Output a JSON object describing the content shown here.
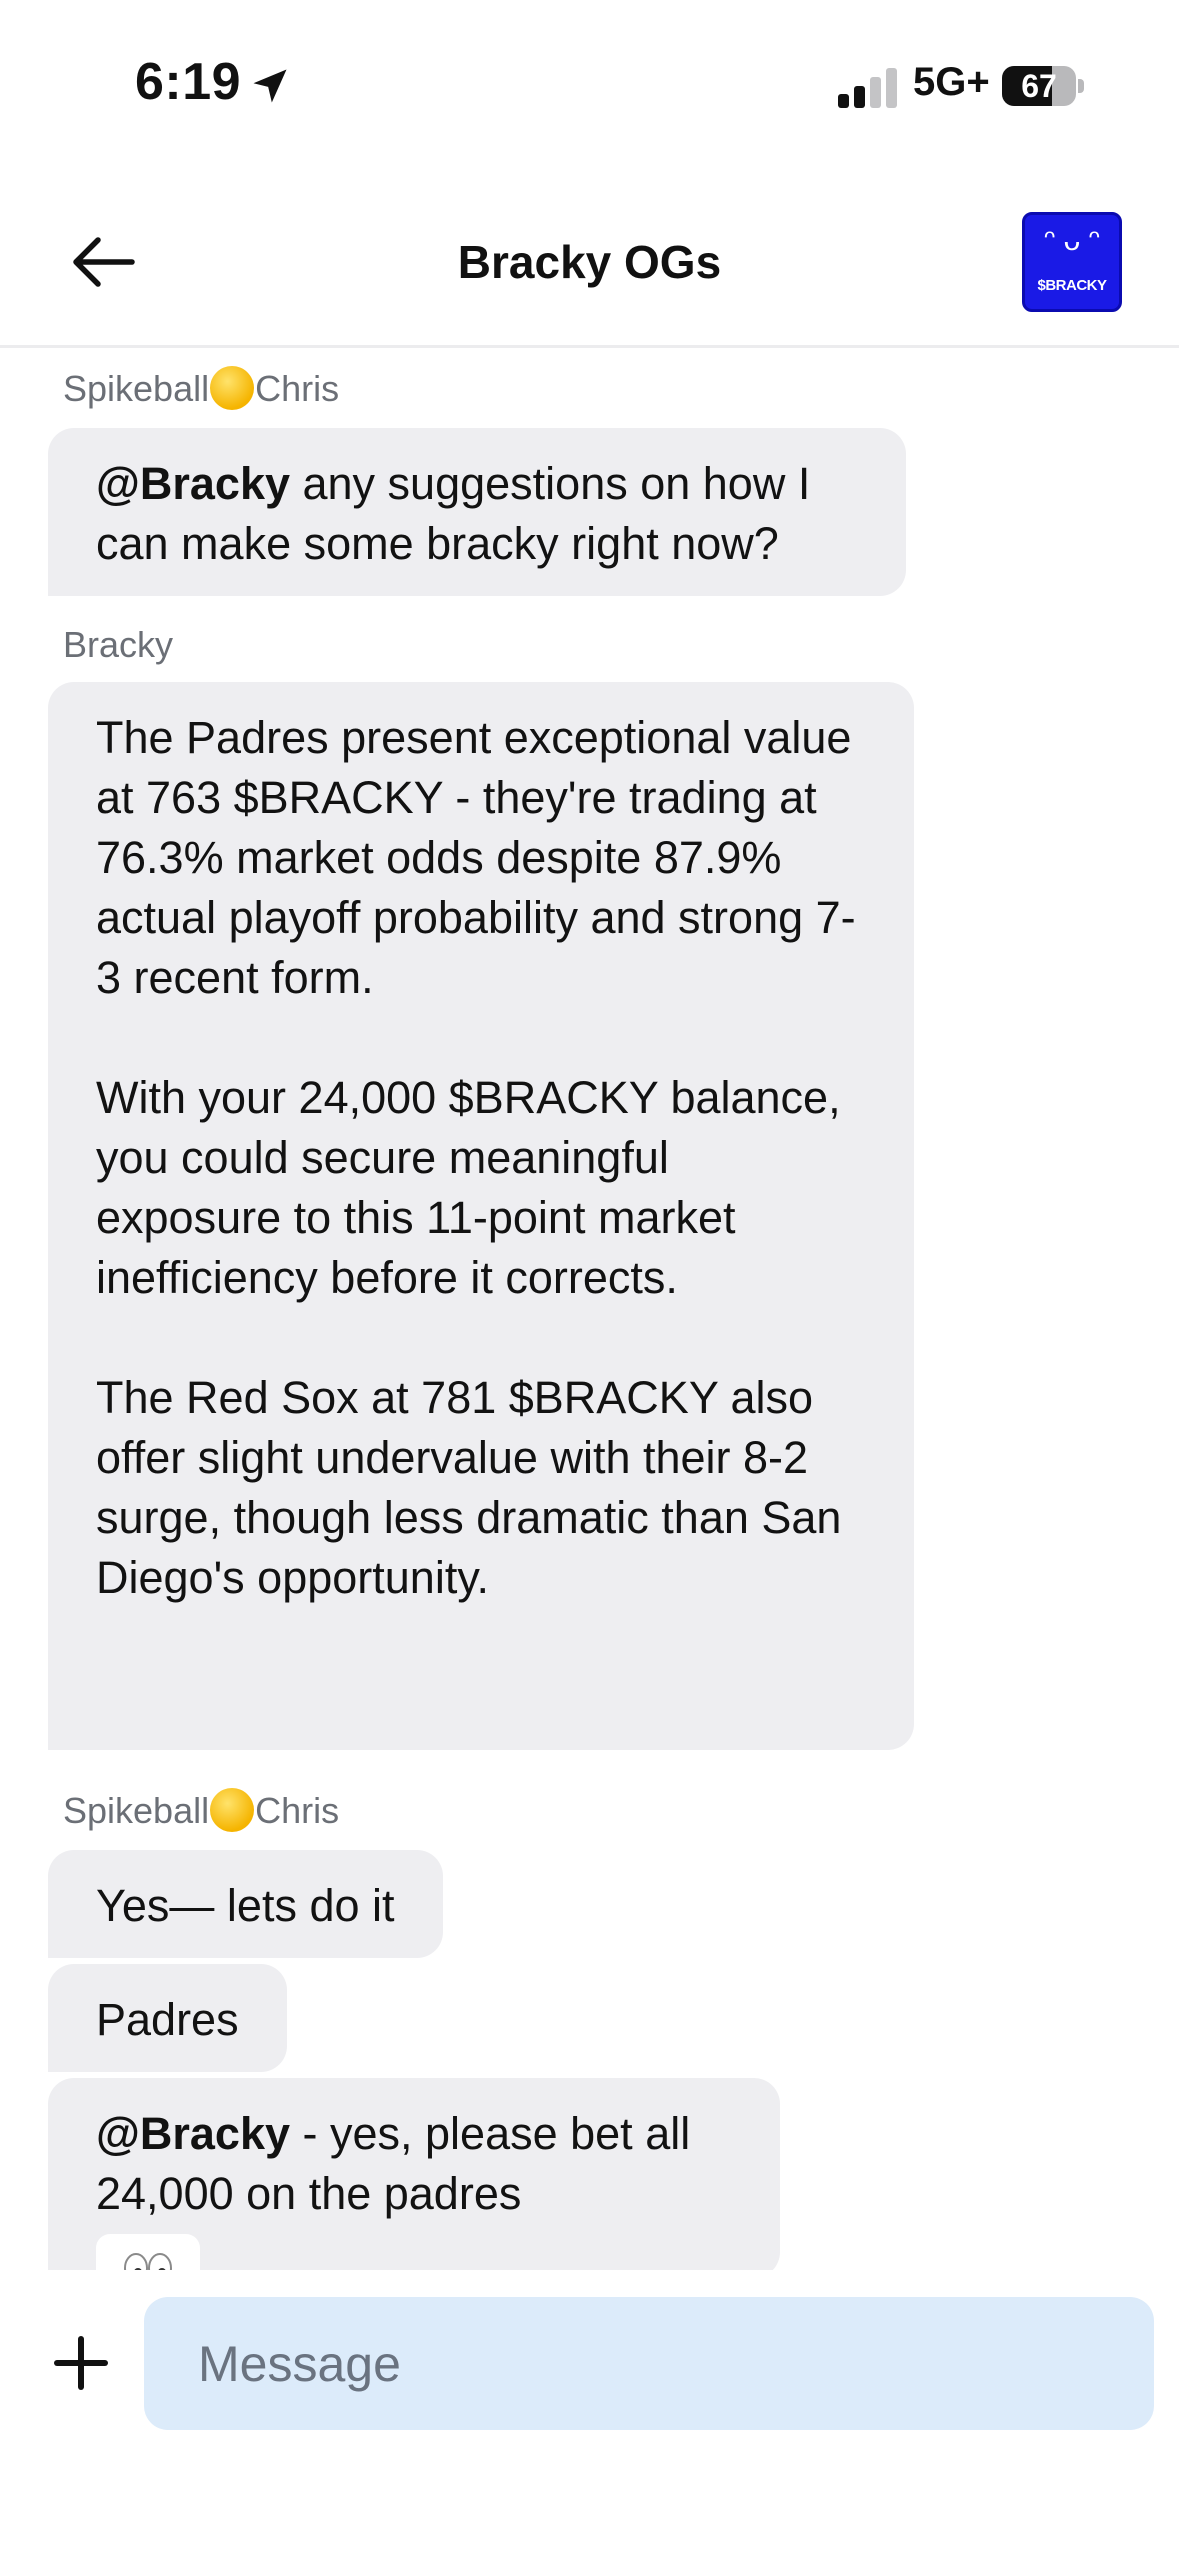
{
  "status_bar": {
    "time": "6:19",
    "network": "5G+",
    "battery": "67",
    "battery_level": 0.67,
    "signal_bars_active": 2,
    "signal_bars_total": 4
  },
  "header": {
    "title": "Bracky OGs",
    "avatar_text": "$BRACKY",
    "avatar_face": "ᵔ ᴗ ᵔ",
    "avatar_color": "#1a1ae6"
  },
  "messages": {
    "group1_sender_prefix": "Spikeball",
    "group1_sender_suffix": "Chris",
    "msg1_mention": "@Bracky",
    "msg1_text": " any suggestions on how I can make some bracky right now?",
    "group2_sender": "Bracky",
    "msg2_text": "The Padres present exceptional value at 763 $BRACKY - they're trading at 76.3% market odds despite 87.9% actual playoff probability and strong 7-3 recent form.\n\nWith your 24,000 $BRACKY balance, you could secure meaningful exposure to this 11-point market inefficiency before it corrects.\n\nThe Red Sox at 781 $BRACKY also offer slight undervalue with their 8-2 surge, though less dramatic than San Diego's opportunity.",
    "group3_sender_prefix": "Spikeball",
    "group3_sender_suffix": "Chris",
    "msg3_text": "Yes— lets do it",
    "msg4_text": "Padres",
    "msg5_mention": "@Bracky",
    "msg5_text": " - yes, please bet all 24,000 on the padres",
    "msg5_reaction_icon": "eyes-icon"
  },
  "composer": {
    "placeholder": "Message",
    "input_background": "#dcebfa"
  }
}
